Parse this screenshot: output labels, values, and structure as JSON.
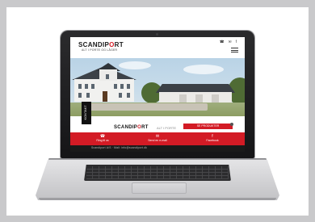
{
  "site": {
    "logo_part1": "SCANDIP",
    "logo_part2": "O",
    "logo_part3": "RT",
    "tagline": "ALT I PORTE OG LÅGER",
    "header_icons": "☎ ✉ f",
    "side_tab": "KONTAKT",
    "brand_logo_part1": "SCANDIP",
    "brand_logo_part2": "O",
    "brand_logo_part3": "RT",
    "brand_tagline": "ALT I PORTE",
    "cta_label": "SE PRODUKTER",
    "nav": [
      {
        "icon": "☎",
        "label": "Ring til os"
      },
      {
        "icon": "✉",
        "label": "Send en e-mail"
      },
      {
        "icon": "f",
        "label": "Facebook"
      }
    ],
    "footer": "Scandiport A/S · Mail: info@scandiport.dk"
  },
  "colors": {
    "brand_red": "#d31b25",
    "laptop_bezel": "#1f1f21",
    "background": "#c9c9cb"
  },
  "icons": [
    "phone-icon",
    "mail-icon",
    "facebook-icon",
    "hamburger-menu-icon"
  ]
}
